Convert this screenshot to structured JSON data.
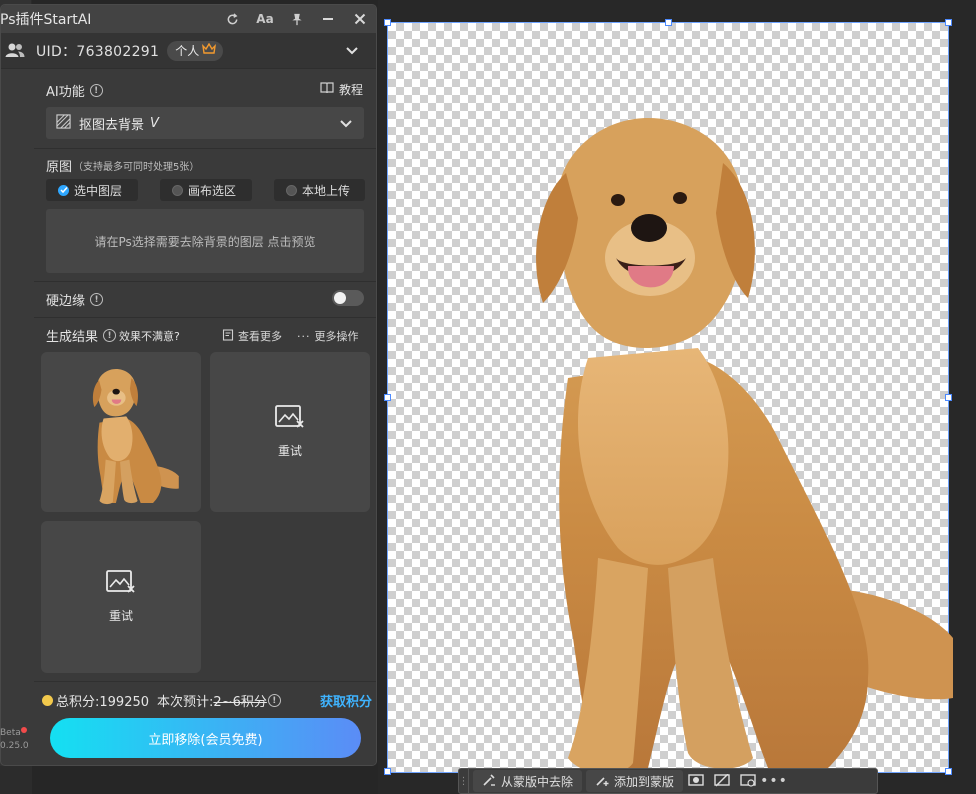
{
  "app": {
    "title": "Ps插件StartAI",
    "font_button": "Aa"
  },
  "account": {
    "uid": "UID：763802291",
    "plan": "个人"
  },
  "ai_function": {
    "label": "AI功能",
    "tutorial": "教程",
    "selected": "抠图去背景",
    "version": "V"
  },
  "source": {
    "label": "原图",
    "hint": "（支持最多可同时处理5张）",
    "options": [
      "选中图层",
      "画布选区",
      "本地上传"
    ],
    "drop_text": "请在Ps选择需要去除背景的图层 点击预览"
  },
  "hard_edge": {
    "label": "硬边缘"
  },
  "results": {
    "label": "生成结果",
    "feedback": "效果不满意?",
    "view_more": "查看更多",
    "more_actions": "更多操作",
    "retry": "重试"
  },
  "footer": {
    "points_label": "总积分:199250",
    "estimate_label": "本次预计:",
    "estimate_value": "2~6积分",
    "get_points": "获取积分",
    "cta": "立即移除(会员免费)"
  },
  "version": {
    "beta": "Beta",
    "number": "0.25.0"
  },
  "context_bar": {
    "remove_from_mask": "从蒙版中去除",
    "add_to_mask": "添加到蒙版"
  },
  "colors": {
    "accent": "#2fa7ff",
    "cta_start": "#14e0f2",
    "cta_end": "#5b8cf6",
    "link": "#3fb4ff"
  }
}
